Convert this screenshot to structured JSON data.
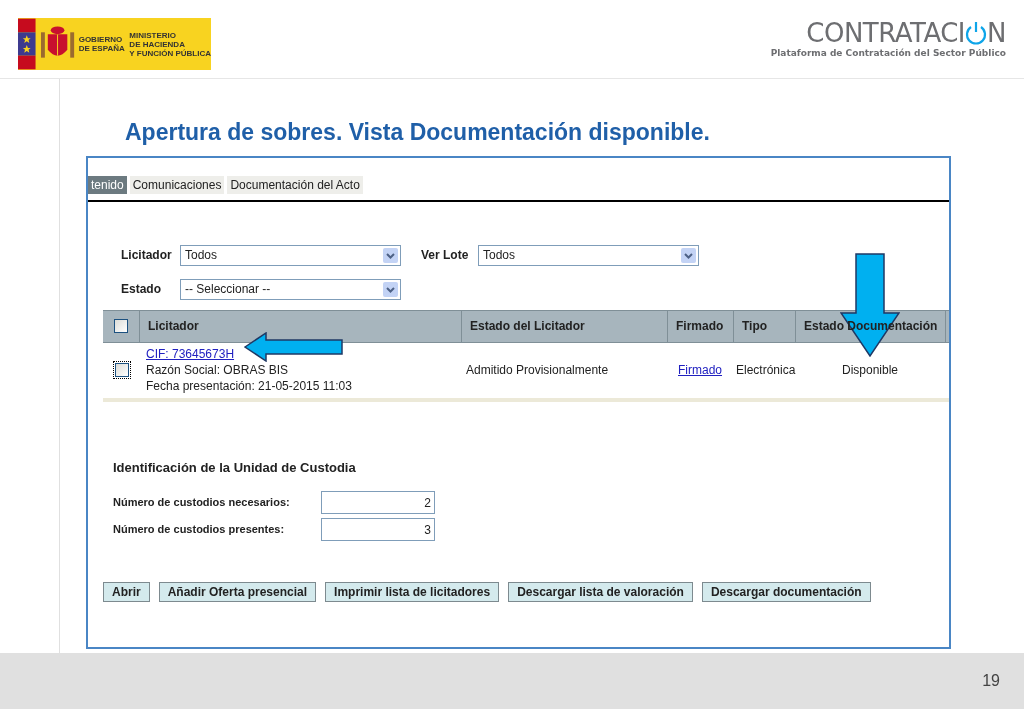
{
  "header": {
    "gov_logo": {
      "line_1": "GOBIERNO",
      "line_2": "DE ESPAÑA",
      "ministry_1": "MINISTERIO",
      "ministry_2": "DE HACIENDA",
      "ministry_3": "Y FUNCIÓN PÚBLICA"
    },
    "brand": {
      "name_start": "CONTRATACI",
      "name_end": "N",
      "subtitle": "Plataforma de Contratación del Sector Público"
    }
  },
  "slide_title": "Apertura de sobres. Vista Documentación disponible.",
  "tabs": [
    {
      "label": "tenido",
      "selected": true
    },
    {
      "label": "Comunicaciones",
      "selected": false
    },
    {
      "label": "Documentación del Acto",
      "selected": false
    }
  ],
  "filters": {
    "licitador": {
      "label": "Licitador",
      "value": "Todos"
    },
    "ver_lote": {
      "label": "Ver Lote",
      "value": "Todos"
    },
    "estado": {
      "label": "Estado",
      "value": "-- Seleccionar --"
    }
  },
  "table": {
    "select_all_checked": false,
    "columns": [
      "Licitador",
      "Estado del Licitador",
      "Firmado",
      "Tipo",
      "Estado Documentación"
    ],
    "rows": [
      {
        "checked": false,
        "cif": "CIF: 73645673H",
        "razon_social": "Razón Social: OBRAS BIS",
        "fecha": "Fecha presentación: 21-05-2015 11:03",
        "estado": "Admitido Provisionalmente",
        "firmado": "Firmado",
        "tipo": "Electrónica",
        "estado_documentacion": "Disponible"
      }
    ]
  },
  "custodia": {
    "title": "Identificación de la Unidad de Custodia",
    "fields": [
      {
        "label": "Número de custodios necesarios:",
        "value": "2"
      },
      {
        "label": "Número de custodios presentes:",
        "value": "3"
      }
    ]
  },
  "buttons": [
    "Abrir",
    "Añadir Oferta presencial",
    "Imprimir lista de licitadores",
    "Descargar lista de valoración",
    "Descargar documentación"
  ],
  "page_number": "19"
}
